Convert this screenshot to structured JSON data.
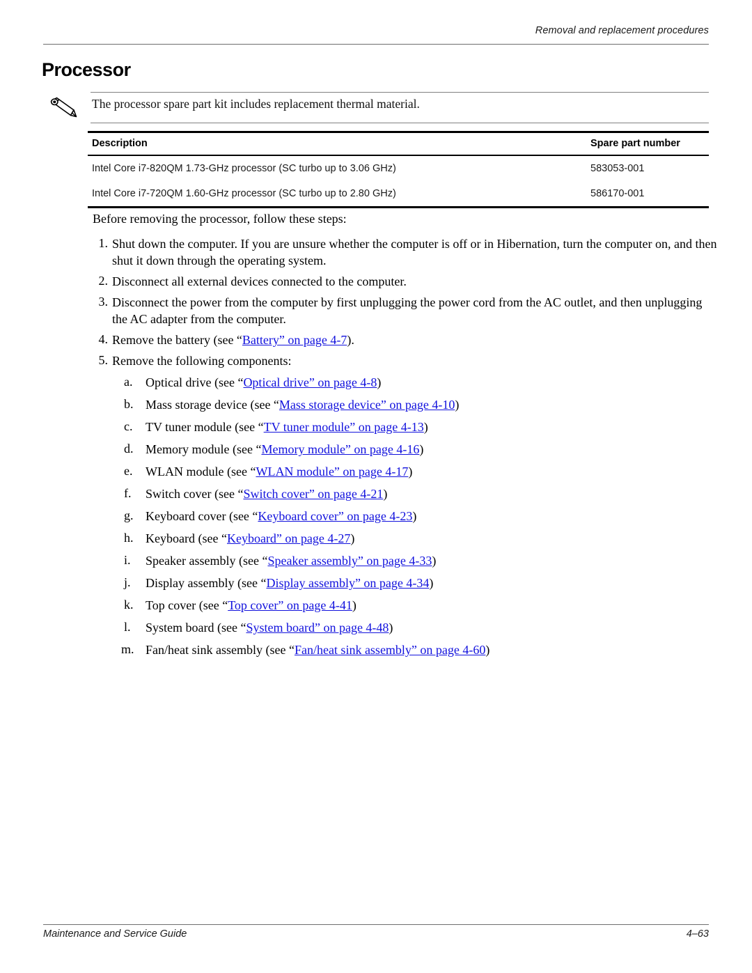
{
  "header": {
    "running_head": "Removal and replacement procedures"
  },
  "title": "Processor",
  "note": {
    "icon": "pencil-note-icon",
    "text": "The processor spare part kit includes replacement thermal material."
  },
  "parts_table": {
    "columns": [
      "Description",
      "Spare part number"
    ],
    "rows": [
      {
        "description": "Intel Core i7-820QM 1.73-GHz processor (SC turbo up to 3.06 GHz)",
        "spare_part_number": "583053-001"
      },
      {
        "description": "Intel Core i7-720QM 1.60-GHz processor (SC turbo up to 2.80 GHz)",
        "spare_part_number": "586170-001"
      }
    ]
  },
  "intro": "Before removing the processor, follow these steps:",
  "steps": [
    {
      "marker": "1.",
      "text": "Shut down the computer. If you are unsure whether the computer is off or in Hibernation, turn the computer on, and then shut it down through the operating system."
    },
    {
      "marker": "2.",
      "text": "Disconnect all external devices connected to the computer."
    },
    {
      "marker": "3.",
      "text": "Disconnect the power from the computer by first unplugging the power cord from the AC outlet, and then unplugging the AC adapter from the computer."
    },
    {
      "marker": "4.",
      "prefix": "Remove the battery (see “",
      "link": "Battery” on page 4-7",
      "suffix": ")."
    },
    {
      "marker": "5.",
      "text": "Remove the following components:"
    }
  ],
  "substeps": [
    {
      "marker": "a.",
      "prefix": "Optical drive (see “",
      "link": "Optical drive” on page 4-8",
      "suffix": ")"
    },
    {
      "marker": "b.",
      "prefix": "Mass storage device (see “",
      "link": "Mass storage device” on page 4-10",
      "suffix": ")"
    },
    {
      "marker": "c.",
      "prefix": "TV tuner module (see “",
      "link": "TV tuner module” on page 4-13",
      "suffix": ")"
    },
    {
      "marker": "d.",
      "prefix": "Memory module (see “",
      "link": "Memory module” on page 4-16",
      "suffix": ")"
    },
    {
      "marker": "e.",
      "prefix": "WLAN module (see “",
      "link": "WLAN module” on page 4-17",
      "suffix": ")"
    },
    {
      "marker": "f.",
      "prefix": "Switch cover (see “",
      "link": "Switch cover” on page 4-21",
      "suffix": ")"
    },
    {
      "marker": "g.",
      "prefix": "Keyboard cover (see “",
      "link": "Keyboard cover” on page 4-23",
      "suffix": ")"
    },
    {
      "marker": "h.",
      "prefix": "Keyboard (see “",
      "link": "Keyboard” on page 4-27",
      "suffix": ")"
    },
    {
      "marker": "i.",
      "prefix": "Speaker assembly (see “",
      "link": "Speaker assembly” on page 4-33",
      "suffix": ")"
    },
    {
      "marker": "j.",
      "prefix": "Display assembly (see “",
      "link": "Display assembly” on page 4-34",
      "suffix": ")"
    },
    {
      "marker": "k.",
      "prefix": "Top cover (see “",
      "link": "Top cover” on page 4-41",
      "suffix": ")"
    },
    {
      "marker": "l.",
      "prefix": "System board (see “",
      "link": "System board” on page 4-48",
      "suffix": ")"
    },
    {
      "marker": "m.",
      "prefix": "Fan/heat sink assembly (see “",
      "link": "Fan/heat sink assembly” on page 4-60",
      "suffix": ")"
    }
  ],
  "footer": {
    "guide_name": "Maintenance and Service Guide",
    "page_number": "4–63"
  },
  "colors": {
    "link": "#1111dd",
    "rule": "#6e6e6e",
    "text": "#000000"
  }
}
